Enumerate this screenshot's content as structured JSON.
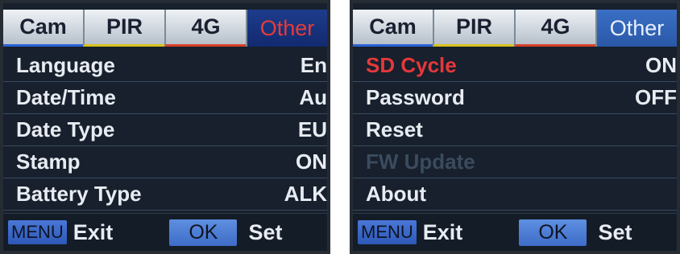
{
  "left_screen": {
    "tabs": [
      "Cam",
      "PIR",
      "4G",
      "Other"
    ],
    "rows": [
      {
        "label": "Language",
        "value": "En"
      },
      {
        "label": "Date/Time",
        "value": "Au"
      },
      {
        "label": "Date Type",
        "value": "EU"
      },
      {
        "label": "Stamp",
        "value": "ON"
      },
      {
        "label": "Battery Type",
        "value": "ALK"
      }
    ],
    "footer": {
      "menu_key": "MENU",
      "exit": "Exit",
      "ok_key": "OK",
      "set": "Set"
    }
  },
  "right_screen": {
    "tabs": [
      "Cam",
      "PIR",
      "4G",
      "Other"
    ],
    "rows": [
      {
        "label": "SD Cycle",
        "value": "ON",
        "state": "highlighted"
      },
      {
        "label": "Password",
        "value": "OFF"
      },
      {
        "label": "Reset",
        "value": ""
      },
      {
        "label": "FW Update",
        "value": "",
        "state": "disabled"
      },
      {
        "label": "About",
        "value": ""
      }
    ],
    "footer": {
      "menu_key": "MENU",
      "exit": "Exit",
      "ok_key": "OK",
      "set": "Set"
    }
  },
  "colors": {
    "screen_bg": "#17202c",
    "highlight_text": "#e5383b",
    "cam_tab_underline": "#2a62d6",
    "pir_tab_underline": "#d8c21c",
    "4g_tab_underline": "#d8402a",
    "disabled_text": "#3b4b5e"
  }
}
